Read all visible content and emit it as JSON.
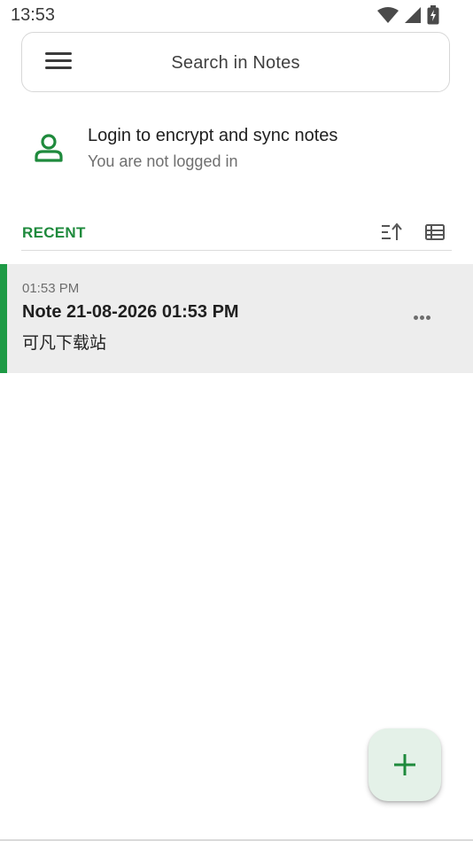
{
  "status_bar": {
    "time": "13:53",
    "icons": [
      "wifi-icon",
      "signal-icon",
      "battery-charging-icon"
    ]
  },
  "search": {
    "placeholder": "Search in Notes",
    "menu_icon": "hamburger-menu-icon"
  },
  "login": {
    "title": "Login to encrypt and sync notes",
    "subtitle": "You are not logged in",
    "icon": "person-icon"
  },
  "recent": {
    "label": "RECENT",
    "sort_icon": "sort-ascending-icon",
    "view_icon": "list-view-icon"
  },
  "notes": [
    {
      "time": "01:53 PM",
      "title": "Note 21-08-2026 01:53 PM",
      "body": "可凡下载站",
      "more_icon": "more-horizontal-icon"
    }
  ],
  "fab": {
    "icon": "plus-icon"
  },
  "colors": {
    "accent": "#1e8a3c",
    "note_accent": "#1e9a45",
    "note_bg": "#ededed",
    "fab_bg": "#e4f1e8"
  }
}
